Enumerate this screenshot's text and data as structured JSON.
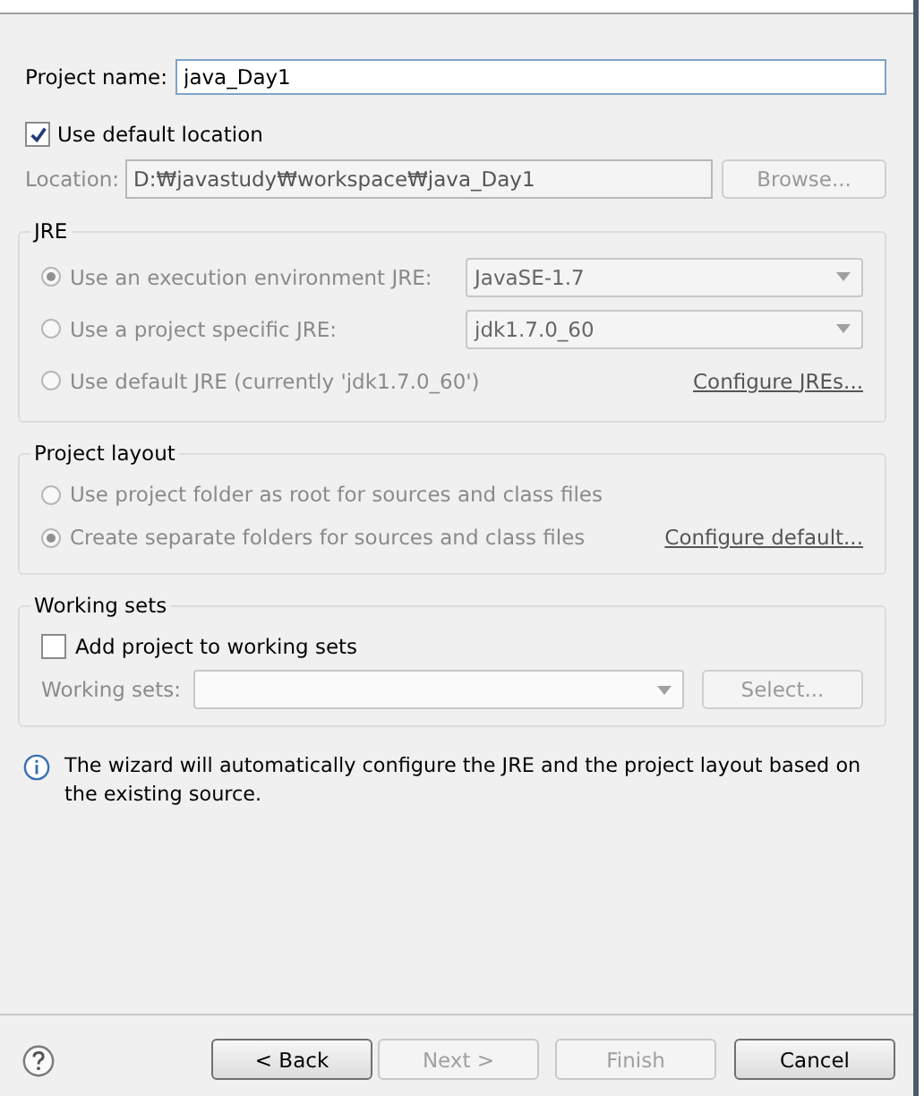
{
  "project_name": {
    "label": "Project name:",
    "value": "java_Day1"
  },
  "use_default_location": {
    "label": "Use default location",
    "checked": true
  },
  "location": {
    "label": "Location:",
    "value": "D:₩javastudy₩workspace₩java_Day1",
    "disabled": true,
    "button": "Browse..."
  },
  "jre": {
    "title": "JRE",
    "options": [
      {
        "label": "Use an execution environment JRE:",
        "selected": true,
        "disabled": true,
        "dropdown": "JavaSE-1.7"
      },
      {
        "label": "Use a project specific JRE:",
        "selected": false,
        "disabled": true,
        "dropdown": "jdk1.7.0_60"
      },
      {
        "label": "Use default JRE (currently 'jdk1.7.0_60')",
        "selected": false,
        "disabled": true,
        "link": "Configure JREs..."
      }
    ]
  },
  "project_layout": {
    "title": "Project layout",
    "options": [
      {
        "label": "Use project folder as root for sources and class files",
        "selected": false,
        "disabled": true
      },
      {
        "label": "Create separate folders for sources and class files",
        "selected": true,
        "disabled": true,
        "link": "Configure default..."
      }
    ]
  },
  "working_sets": {
    "title": "Working sets",
    "checkbox": {
      "label": "Add project to working sets",
      "checked": false
    },
    "field_label": "Working sets:",
    "disabled": true,
    "button": "Select..."
  },
  "info": "The wizard will automatically configure the JRE and the project layout based on the existing source.",
  "buttons": [
    {
      "label": "< Back",
      "disabled": false
    },
    {
      "label": "Next >",
      "disabled": true
    },
    {
      "label": "Finish",
      "disabled": true
    },
    {
      "label": "Cancel",
      "disabled": false
    }
  ]
}
